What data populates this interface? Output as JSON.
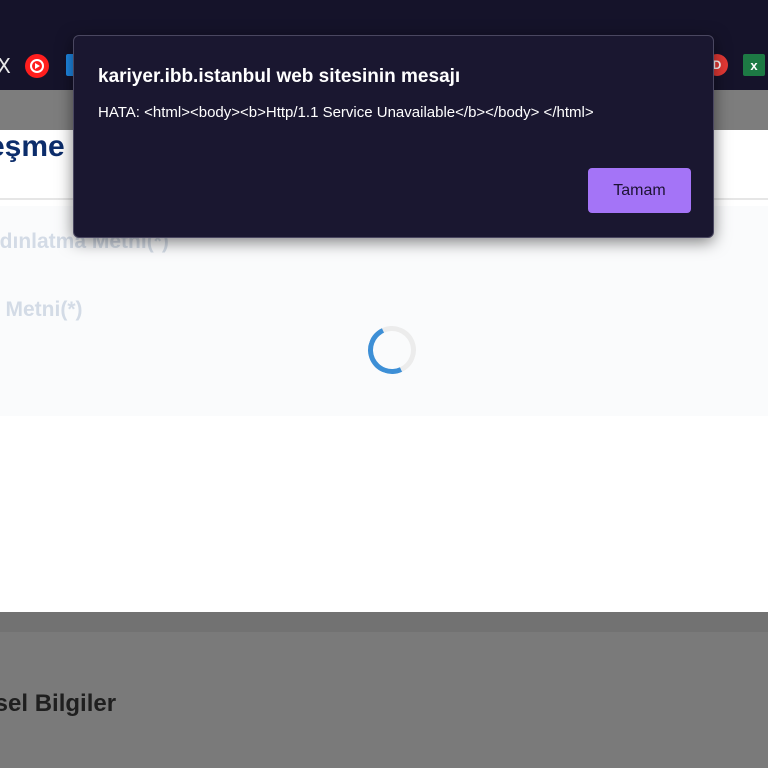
{
  "browser": {
    "bookmarks": [
      {
        "icon": "x-icon",
        "glyph": "X"
      },
      {
        "icon": "youtube-music-icon"
      },
      {
        "icon": "blue-bookmark-icon"
      },
      {
        "icon": "red-circle-icon",
        "glyph": "D"
      },
      {
        "icon": "excel-icon",
        "glyph": "x"
      }
    ]
  },
  "page": {
    "card_title": "eşme",
    "faded_line_1": "ydınlatma Metni(*)",
    "faded_line_2": "e Metni(*)",
    "section_heading": "isel Bilgiler"
  },
  "dialog": {
    "title": "kariyer.ibb.istanbul web sitesinin mesajı",
    "message": "HATA: <html><body><b>Http/1.1 Service Unavailable</b></body> </html>",
    "ok_label": "Tamam"
  },
  "colors": {
    "dialog_bg": "#1a1730",
    "button_accent": "#a474f7",
    "title_blue": "#0c2d6b",
    "spinner_blue": "#3d8fd6"
  }
}
